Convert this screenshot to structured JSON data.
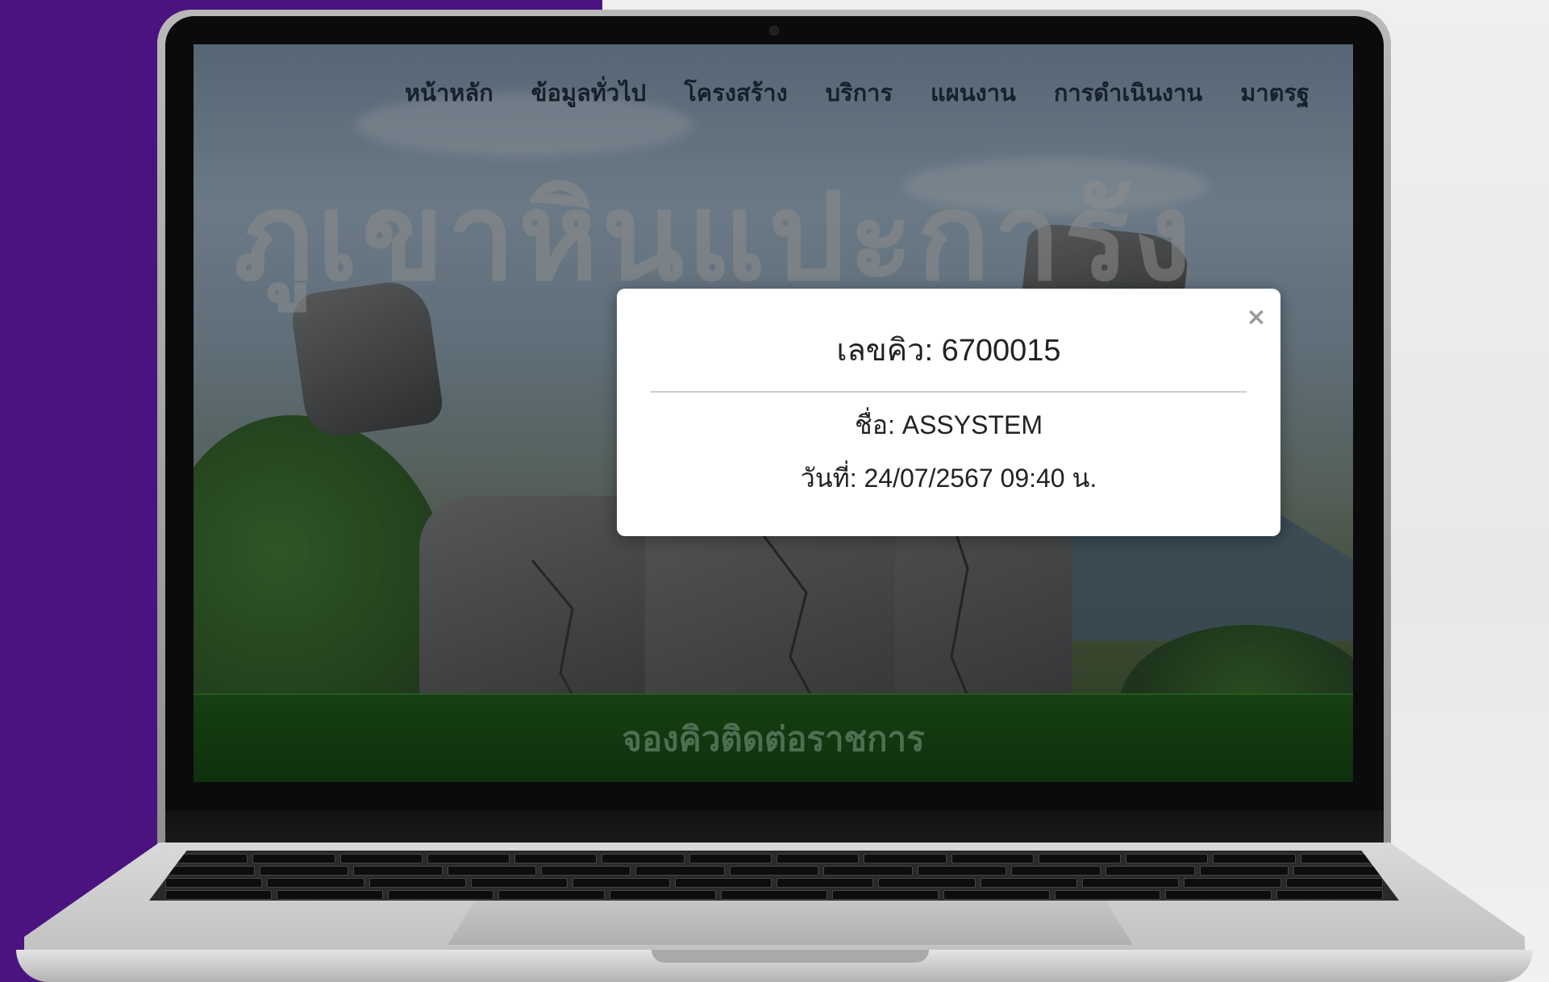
{
  "nav": {
    "items": [
      {
        "label": "หน้าหลัก"
      },
      {
        "label": "ข้อมูลทั่วไป"
      },
      {
        "label": "โครงสร้าง"
      },
      {
        "label": "บริการ"
      },
      {
        "label": "แผนงาน"
      },
      {
        "label": "การดำเนินงาน"
      },
      {
        "label": "มาตรฐ"
      }
    ]
  },
  "hero": {
    "title": "ภูเขาหินแปะการัง"
  },
  "booking": {
    "label": "จองคิวติดต่อราชการ"
  },
  "modal": {
    "close_label": "×",
    "queue_text": "เลขคิว: 6700015",
    "name_text": "ชื่อ: ASSYSTEM",
    "date_text": "วันที่: 24/07/2567 09:40 น."
  },
  "colors": {
    "accent_purple": "#4b1380",
    "band_green": "#163f12"
  }
}
